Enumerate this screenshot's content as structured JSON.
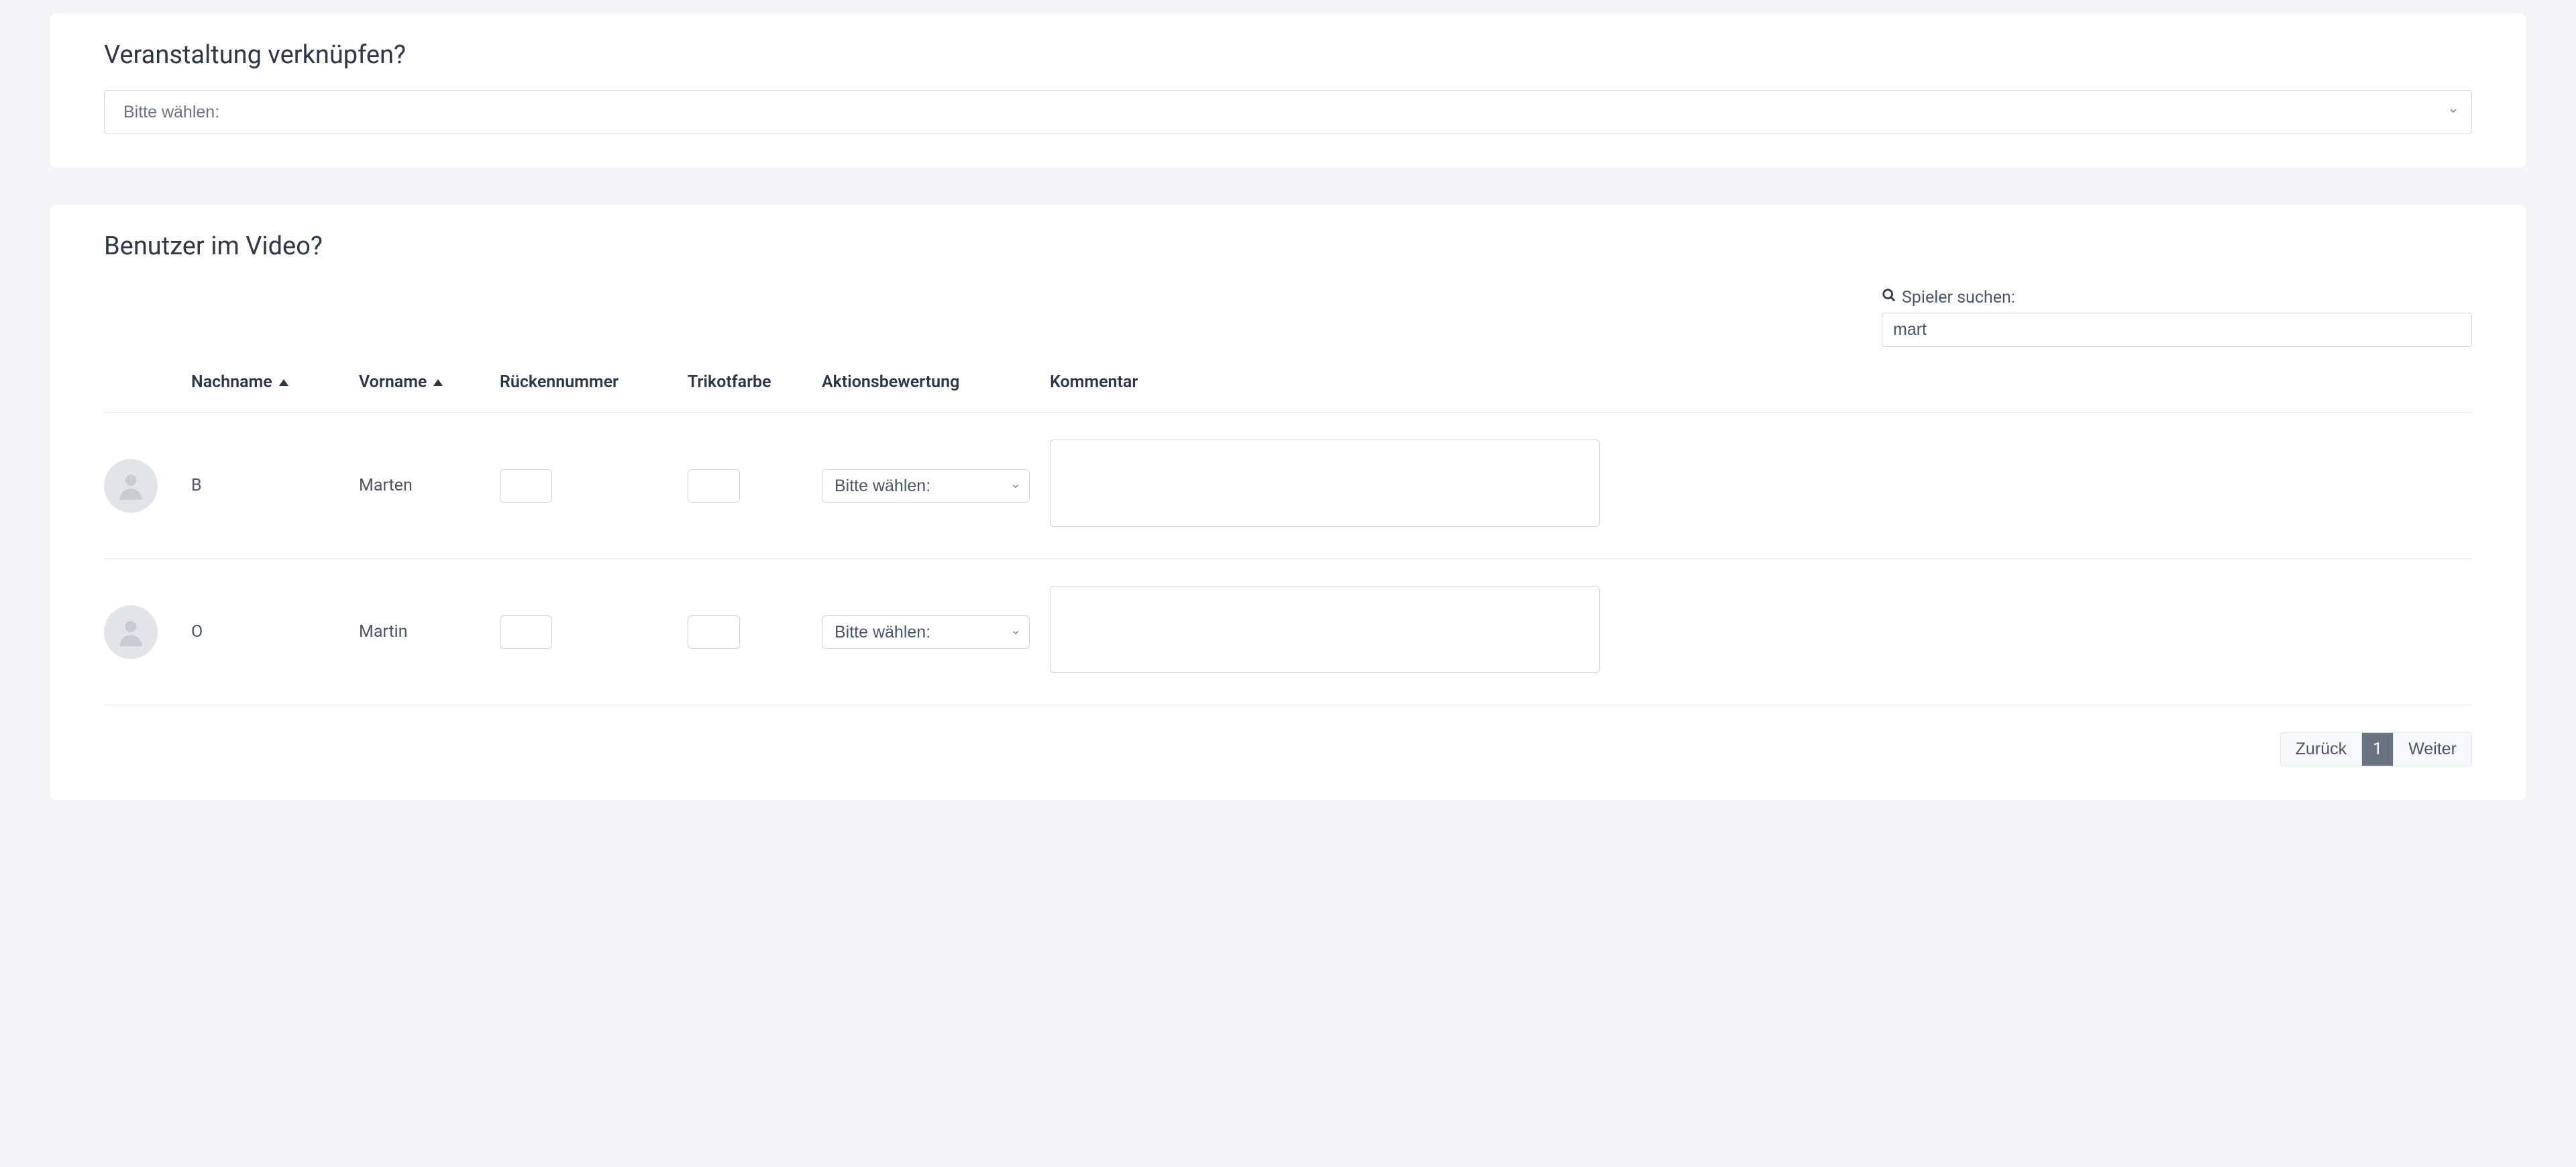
{
  "event_card": {
    "title": "Veranstaltung verknüpfen?",
    "select_placeholder": "Bitte wählen:"
  },
  "users_card": {
    "title": "Benutzer im Video?",
    "search_label": "Spieler suchen:",
    "search_value": "mart",
    "columns": {
      "nachname": "Nachname",
      "vorname": "Vorname",
      "ruckennummer": "Rückennummer",
      "trikotfarbe": "Trikotfarbe",
      "aktionsbewertung": "Aktionsbewertung",
      "kommentar": "Kommentar"
    },
    "rating_placeholder": "Bitte wählen:",
    "rows": [
      {
        "nachname": "B",
        "vorname": "Marten",
        "num": "",
        "color": "",
        "comment": ""
      },
      {
        "nachname": "O",
        "vorname": "Martin",
        "num": "",
        "color": "",
        "comment": ""
      }
    ],
    "pagination": {
      "prev": "Zurück",
      "page": "1",
      "next": "Weiter"
    }
  }
}
